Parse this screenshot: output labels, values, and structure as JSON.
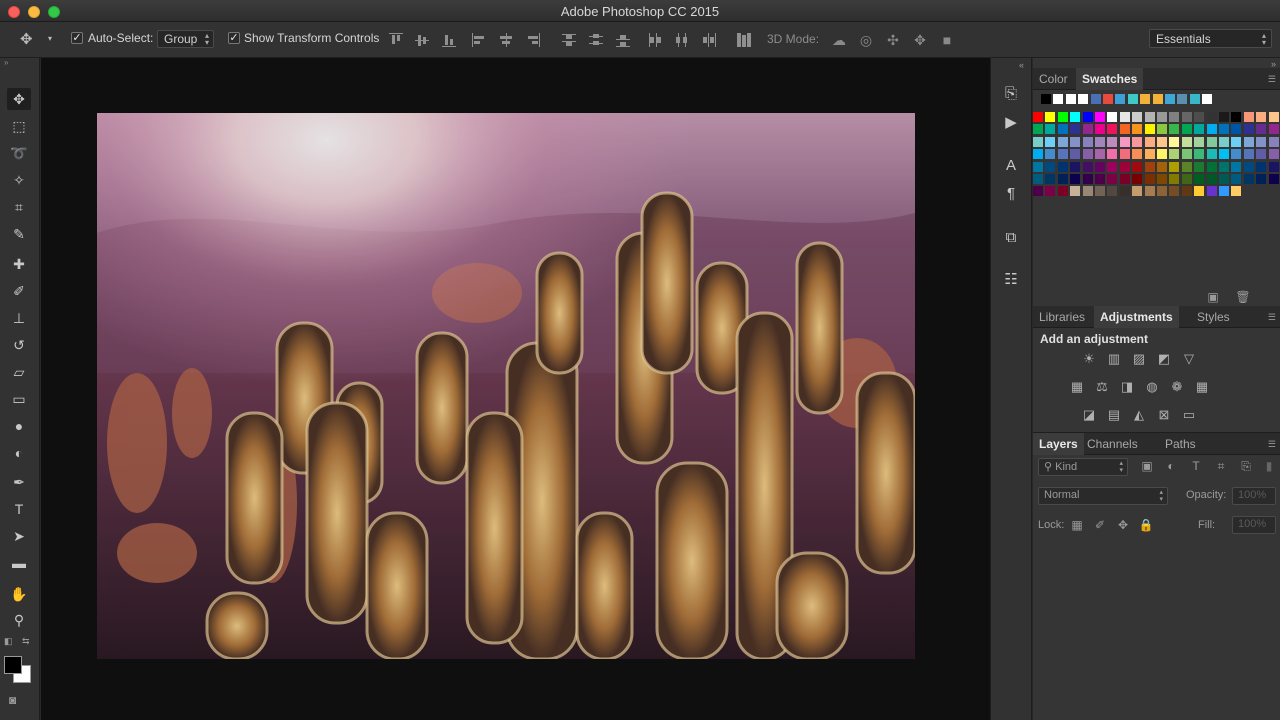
{
  "window": {
    "title": "Adobe Photoshop CC 2015"
  },
  "options_bar": {
    "auto_select_label": "Auto-Select:",
    "auto_select_value": "Group",
    "show_transform_label": "Show Transform Controls",
    "mode_3d_label": "3D Mode:",
    "workspace_value": "Essentials"
  },
  "tools": [
    "move-tool",
    "marquee-tool",
    "lasso-tool",
    "magic-wand-tool",
    "crop-tool",
    "eyedropper-tool",
    "healing-brush-tool",
    "brush-tool",
    "clone-stamp-tool",
    "history-brush-tool",
    "eraser-tool",
    "gradient-tool",
    "blur-tool",
    "dodge-tool",
    "pen-tool",
    "type-tool",
    "path-selection-tool",
    "rectangle-tool",
    "hand-tool",
    "zoom-tool"
  ],
  "color_panel": {
    "tabs": [
      "Color",
      "Swatches"
    ],
    "active_tab": "Swatches",
    "recent_swatches": [
      "#000000",
      "#ffffff",
      "#ffffff",
      "#ffffff",
      "#4b6fb5",
      "#e84b3c",
      "#3d9fd6",
      "#3fc8c8",
      "#f2b23a",
      "#f2b23a",
      "#3fa7d6",
      "#5a8fb0",
      "#37b7c9",
      "#ffffff"
    ],
    "swatch_rows": [
      [
        "#ff0000",
        "#ffff00",
        "#00ff00",
        "#00ffff",
        "#0000ff",
        "#ff00ff",
        "#ffffff",
        "#e6e6e6",
        "#cccccc",
        "#b3b3b3",
        "#999999",
        "#808080",
        "#666666",
        "#4d4d4d",
        "#333333",
        "#1a1a1a",
        "#000000",
        "#f7977a",
        "#f9ad81",
        "#fdc68a",
        "#fff79a"
      ],
      [
        "#00a651",
        "#00a99d",
        "#0072bc",
        "#2e3192",
        "#92278f",
        "#ec008c",
        "#ed145b",
        "#f26522",
        "#f7941d",
        "#fff200",
        "#8dc63f",
        "#39b54a",
        "#00a651",
        "#00a99d",
        "#00aeef",
        "#0072bc",
        "#0054a6",
        "#2e3192",
        "#662d91",
        "#92278f",
        "#ec008c"
      ],
      [
        "#7accc8",
        "#6dcff6",
        "#7da7d9",
        "#8393ca",
        "#8781bd",
        "#a186be",
        "#bd8cbf",
        "#f49ac2",
        "#f6989d",
        "#f9ad81",
        "#fdc68a",
        "#fff799",
        "#c4df9b",
        "#a3d39c",
        "#82ca9c",
        "#7accc8",
        "#6dcff6",
        "#7da7d9",
        "#8393ca",
        "#8781bd",
        "#a186be"
      ],
      [
        "#00aeef",
        "#448ccb",
        "#5674b9",
        "#605ca8",
        "#8560a8",
        "#a864a8",
        "#f06eaa",
        "#f26c7d",
        "#f68e56",
        "#fbaf5d",
        "#fff467",
        "#acd373",
        "#7cc576",
        "#3cb878",
        "#1cbbb4",
        "#00bff3",
        "#448ccb",
        "#5674b9",
        "#605ca8",
        "#8560a8",
        "#a864a8"
      ],
      [
        "#0076a3",
        "#004a80",
        "#003471",
        "#1b1464",
        "#440e62",
        "#630460",
        "#9e005d",
        "#9e0039",
        "#9e0b0f",
        "#a0410d",
        "#a36209",
        "#aba000",
        "#598527",
        "#1a7b30",
        "#007236",
        "#00746b",
        "#0076a3",
        "#004a80",
        "#003471",
        "#1b1464",
        "#440e62"
      ],
      [
        "#005b7f",
        "#003663",
        "#002157",
        "#0d004c",
        "#32004b",
        "#4b0049",
        "#7b0046",
        "#7a0026",
        "#790000",
        "#7b2e00",
        "#7d4900",
        "#827b00",
        "#406618",
        "#005e20",
        "#005826",
        "#005952",
        "#005b7f",
        "#003663",
        "#002157",
        "#0d004c",
        "#32004b"
      ],
      [
        "#4b0049",
        "#7b0046",
        "#7a0026",
        "#c7b299",
        "#998675",
        "#736357",
        "#534741",
        "#37302a",
        "#c69c6d",
        "#a67c52",
        "#8c6239",
        "#754c24",
        "#603913",
        "#ffcc33",
        "#6633cc",
        "#3399ff",
        "#ffcc66"
      ]
    ]
  },
  "adjustments_panel": {
    "tabs": [
      "Libraries",
      "Adjustments",
      "Styles"
    ],
    "active_tab": "Adjustments",
    "heading": "Add an adjustment",
    "icons_row1": [
      "brightness-icon",
      "levels-icon",
      "curves-icon",
      "exposure-icon",
      "vibrance-icon"
    ],
    "icons_row2": [
      "hue-saturation-icon",
      "color-balance-icon",
      "black-white-icon",
      "photo-filter-icon",
      "channel-mixer-icon",
      "color-lookup-icon"
    ],
    "icons_row3": [
      "invert-icon",
      "posterize-icon",
      "threshold-icon",
      "selective-color-icon",
      "gradient-map-icon"
    ]
  },
  "layers_panel": {
    "tabs": [
      "Layers",
      "Channels",
      "Paths"
    ],
    "active_tab": "Layers",
    "filter_label": "Kind",
    "blend_mode": "Normal",
    "opacity_label": "Opacity:",
    "opacity_value": "100%",
    "lock_label": "Lock:",
    "fill_label": "Fill:",
    "fill_value": "100%"
  }
}
